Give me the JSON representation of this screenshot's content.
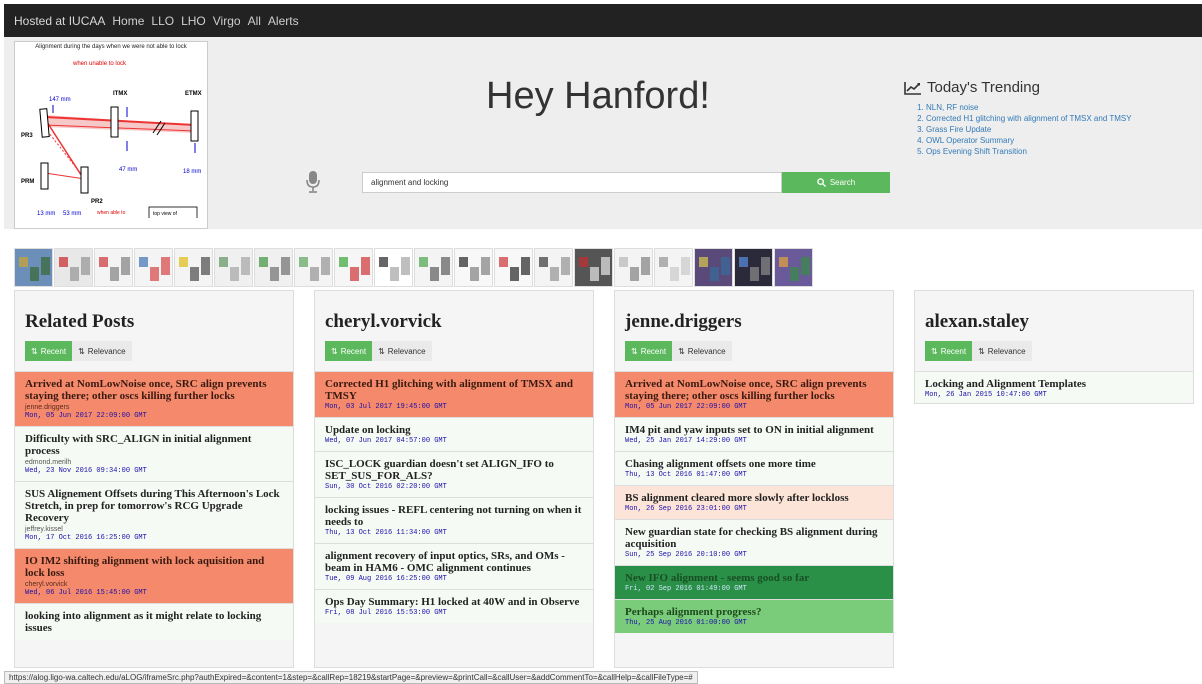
{
  "navbar": {
    "brand": "Hosted at IUCAA",
    "links": [
      "Home",
      "LLO",
      "LHO",
      "Virgo",
      "All",
      "Alerts"
    ]
  },
  "feature_image": {
    "caption": "Alignment during the days when we were not able to lock",
    "labels": {
      "unable": "when unable to lock",
      "itmx": "ITMX",
      "etmx": "ETMX",
      "pr3": "PR3",
      "prm": "PRM",
      "pr2": "PR2",
      "m147": "147 mm",
      "m47": "47 mm",
      "m18": "18 mm",
      "m13": "13 mm",
      "m53": "53 mm",
      "able": "when able to",
      "topview": "top view of"
    }
  },
  "hero": {
    "title": "Hey Hanford!",
    "mic_icon": "microphone-icon"
  },
  "search": {
    "value": "alignment and locking",
    "button_label": "Search",
    "icon": "search-icon"
  },
  "trending": {
    "title": "Today's Trending",
    "icon": "trend-chart-icon",
    "items": [
      "NLN, RF noise",
      "Corrected H1 glitching with alignment of TMSX and TMSY",
      "Grass Fire Update",
      "OWL Operator Summary",
      "Ops Evening Shift Transition"
    ]
  },
  "columns": [
    {
      "title": "Related Posts",
      "recent_label": "Recent",
      "relevance_label": "Relevance",
      "posts": [
        {
          "title": "Arrived at NomLowNoise once, SRC align prevents staying there; other oscs killing further locks",
          "author": "jenne.driggers",
          "date": "Mon, 05 Jun 2017 22:09:00 GMT",
          "style": "orange"
        },
        {
          "title": "Difficulty with SRC_ALIGN in initial alignment process",
          "author": "edmond.merilh",
          "date": "Wed, 23 Nov 2016 09:34:00 GMT",
          "style": "plain"
        },
        {
          "title": "SUS Alignement Offsets during This Afternoon's Lock Stretch, in prep for tomorrow's RCG Upgrade Recovery",
          "author": "jeffrey.kissel",
          "date": "Mon, 17 Oct 2016 16:25:00 GMT",
          "style": "plain"
        },
        {
          "title": "IO IM2 shifting alignment with lock aquisition and lock loss",
          "author": "cheryl.vorvick",
          "date": "Wed, 06 Jul 2016 15:45:00 GMT",
          "style": "orange"
        },
        {
          "title": "looking into alignment as it might relate to locking issues",
          "author": "",
          "date": "",
          "style": "plain"
        }
      ]
    },
    {
      "title": "cheryl.vorvick",
      "recent_label": "Recent",
      "relevance_label": "Relevance",
      "posts": [
        {
          "title": "Corrected H1 glitching with alignment of TMSX and TMSY",
          "author": "",
          "date": "Mon, 03 Jul 2017 19:45:00 GMT",
          "style": "orange"
        },
        {
          "title": "Update on locking",
          "author": "",
          "date": "Wed, 07 Jun 2017 04:57:00 GMT",
          "style": "plain"
        },
        {
          "title": "ISC_LOCK guardian doesn't set ALIGN_IFO to SET_SUS_FOR_ALS?",
          "author": "",
          "date": "Sun, 30 Oct 2016 02:20:00 GMT",
          "style": "plain"
        },
        {
          "title": "locking issues - REFL centering not turning on when it needs to",
          "author": "",
          "date": "Thu, 13 Oct 2016 11:34:00 GMT",
          "style": "plain"
        },
        {
          "title": "alignment recovery of input optics, SRs, and OMs - beam in HAM6 - OMC alignment continues",
          "author": "",
          "date": "Tue, 09 Aug 2016 16:25:00 GMT",
          "style": "plain"
        },
        {
          "title": "Ops Day Summary: H1 locked at 40W and in Observe",
          "author": "",
          "date": "Fri, 08 Jul 2016 15:53:00 GMT",
          "style": "plain"
        }
      ]
    },
    {
      "title": "jenne.driggers",
      "recent_label": "Recent",
      "relevance_label": "Relevance",
      "posts": [
        {
          "title": "Arrived at NomLowNoise once, SRC align prevents staying there; other oscs killing further locks",
          "author": "",
          "date": "Mon, 05 Jun 2017 22:09:00 GMT",
          "style": "orange"
        },
        {
          "title": "IM4 pit and yaw inputs set to ON in initial alignment",
          "author": "",
          "date": "Wed, 25 Jan 2017 14:29:00 GMT",
          "style": "plain"
        },
        {
          "title": "Chasing alignment offsets one more time",
          "author": "",
          "date": "Thu, 13 Oct 2016 01:47:00 GMT",
          "style": "plain"
        },
        {
          "title": "BS alignment cleared more slowly after lockloss",
          "author": "",
          "date": "Mon, 26 Sep 2016 23:01:00 GMT",
          "style": "peach"
        },
        {
          "title": "New guardian state for checking BS alignment during acquisition",
          "author": "",
          "date": "Sun, 25 Sep 2016 20:10:00 GMT",
          "style": "plain"
        },
        {
          "title": "New IFO alignment - seems good so far",
          "author": "",
          "date": "Fri, 02 Sep 2016 01:49:00 GMT",
          "style": "darkgreen"
        },
        {
          "title": "Perhaps alignment progress?",
          "author": "",
          "date": "Thu, 25 Aug 2016 01:00:00 GMT",
          "style": "midgreen"
        }
      ]
    },
    {
      "title": "alexan.staley",
      "recent_label": "Recent",
      "relevance_label": "Relevance",
      "posts": [
        {
          "title": "Locking and Alignment Templates",
          "author": "",
          "date": "Mon, 26 Jan 2015 10:47:00 GMT",
          "style": "plain"
        }
      ]
    }
  ],
  "status_url": "https://alog.ligo-wa.caltech.edu/aLOG/iframeSrc.php?authExpired=&content=1&step=&callRep=18219&startPage=&preview=&printCall=&callUser=&addCommentTo=&callHelp=&callFileType=#",
  "colors": {
    "navbar": "#222222",
    "hero_bg": "#eeeeee",
    "accent_green": "#5cb85c",
    "orange_post": "#f48a6b",
    "peach_post": "#fde4d8",
    "darkgreen_post": "#2a8f47",
    "midgreen_post": "#7acb7a",
    "link_blue": "#337ab7"
  }
}
